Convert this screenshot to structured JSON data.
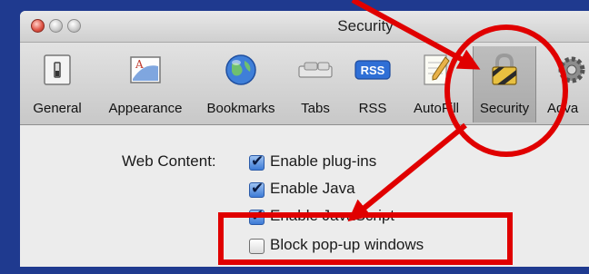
{
  "window": {
    "title": "Security"
  },
  "toolbar": {
    "items": [
      {
        "label": "General",
        "icon": "general-switch-icon"
      },
      {
        "label": "Appearance",
        "icon": "appearance-icon"
      },
      {
        "label": "Bookmarks",
        "icon": "globe-icon"
      },
      {
        "label": "Tabs",
        "icon": "tabs-icon"
      },
      {
        "label": "RSS",
        "icon": "rss-icon",
        "icon_text": "RSS"
      },
      {
        "label": "AutoFill",
        "icon": "autofill-pencil-icon"
      },
      {
        "label": "Security",
        "icon": "lock-icon",
        "selected": true
      },
      {
        "label": "Adva",
        "icon": "gear-icon"
      }
    ]
  },
  "web_content": {
    "label": "Web Content:",
    "options": [
      {
        "label": "Enable plug-ins",
        "checked": true
      },
      {
        "label": "Enable Java",
        "checked": true
      },
      {
        "label": "Enable JavaScript",
        "checked": true
      },
      {
        "label": "Block pop-up windows",
        "checked": false
      }
    ]
  },
  "annotation_color": "#e00000"
}
